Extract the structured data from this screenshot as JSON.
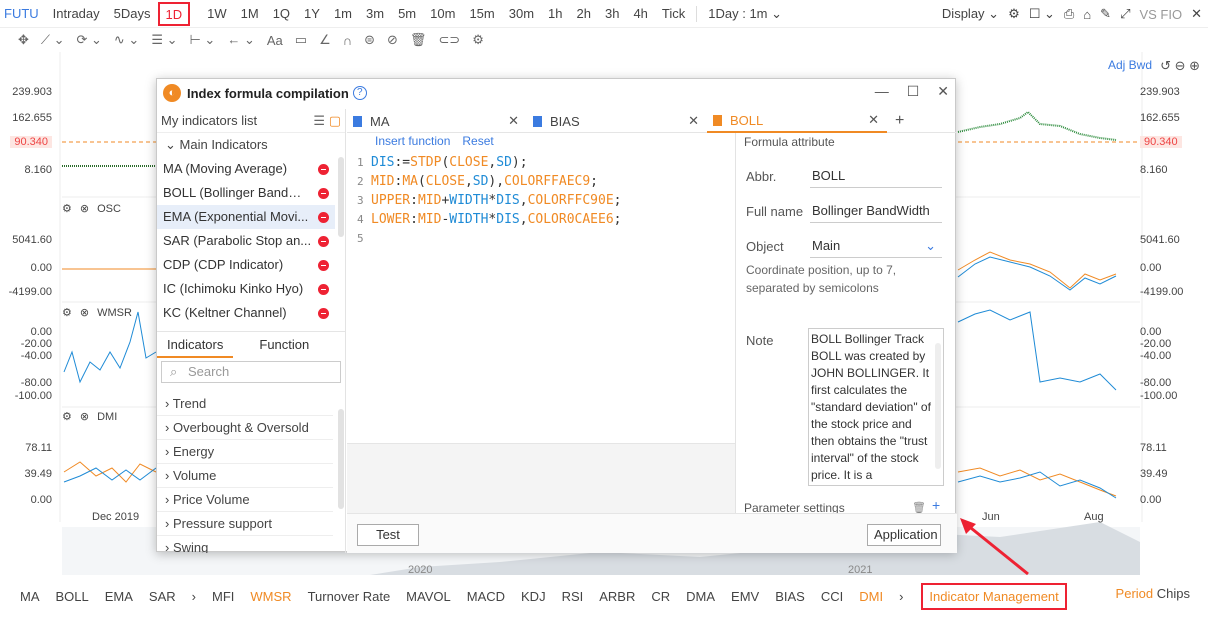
{
  "topbar": {
    "symbol": "FUTU",
    "timeframes": [
      "Intraday",
      "5Days",
      "1D",
      "1W",
      "1M",
      "1Q",
      "1Y",
      "1m",
      "3m",
      "5m",
      "10m",
      "15m",
      "30m",
      "1h",
      "2h",
      "3h",
      "4h",
      "Tick"
    ],
    "active": "1D",
    "interval_select": "1Day : 1m",
    "display_label": "Display",
    "vs_label": "VS FIO"
  },
  "chart": {
    "adj_label": "Adj Bwd",
    "price_axis": [
      "239.903",
      "162.655",
      "90.340",
      "8.160"
    ],
    "price_tag": "90.340",
    "osc_label": "OSC",
    "osc_axis": [
      "5041.60",
      "0.00",
      "-4199.00"
    ],
    "wmsr_label": "WMSR",
    "wmsr_axis": [
      "0.00",
      "-20.00",
      "-40.00",
      "-80.00",
      "-100.00"
    ],
    "dmi_label": "DMI",
    "dmi_axis": [
      "78.11",
      "39.49",
      "0.00"
    ],
    "date_labels": [
      "Dec 2019",
      "Jun",
      "Aug"
    ],
    "years": [
      "2020",
      "2021"
    ]
  },
  "bottom": {
    "items": [
      "MA",
      "BOLL",
      "EMA",
      "SAR",
      "MFI",
      "WMSR",
      "Turnover Rate",
      "MAVOL",
      "MACD",
      "KDJ",
      "RSI",
      "ARBR",
      "CR",
      "DMA",
      "EMV",
      "BIAS",
      "CCI",
      "DMI"
    ],
    "orange_items": [
      "WMSR",
      "DMI"
    ],
    "management": "Indicator Management",
    "period": "Period",
    "chips": "Chips"
  },
  "dialog": {
    "title": "Index formula compilation",
    "my_indicators": "My indicators list",
    "main_group": "Main Indicators",
    "main_items": [
      "MA (Moving Average)",
      "BOLL (Bollinger BandWi...",
      "EMA (Exponential Movi...",
      "SAR (Parabolic Stop an...",
      "CDP (CDP Indicator)",
      "IC (Ichimoku Kinko Hyo)",
      "KC (Keltner Channel)"
    ],
    "selected_item": 2,
    "tab_indicators": "Indicators",
    "tab_function": "Function",
    "search_placeholder": "Search",
    "categories": [
      "Trend",
      "Overbought & Oversold",
      "Energy",
      "Volume",
      "Price Volume",
      "Pressure support",
      "Swing"
    ],
    "file_tabs": [
      "MA",
      "BIAS",
      "BOLL"
    ],
    "active_tab": "BOLL",
    "insert_function": "Insert function",
    "reset": "Reset",
    "code_lines": [
      "DIS:=STDP(CLOSE,SD);",
      "MID:MA(CLOSE,SD),COLORFFAEC9;",
      "UPPER:MID+WIDTH*DIS,COLORFFC90E;",
      "LOWER:MID-WIDTH*DIS,COLOR0CAEE6;",
      ""
    ],
    "formula_attribute": "Formula attribute",
    "abbr_label": "Abbr.",
    "abbr_value": "BOLL",
    "fullname_label": "Full name",
    "fullname_value": "Bollinger BandWidth",
    "object_label": "Object",
    "object_value": "Main",
    "coord_text": "Coordinate position, up to 7, separated by semicolons",
    "note_label": "Note",
    "note_text": "BOLL Bollinger Track BOLL was created by JOHN BOLLINGER. It first calculates the \"standard deviation\" of the stock price and then obtains the \"trust interval\" of the stock price. It is a",
    "parameter_settings": "Parameter settings",
    "test_button": "Test",
    "apply_button": "Application"
  }
}
